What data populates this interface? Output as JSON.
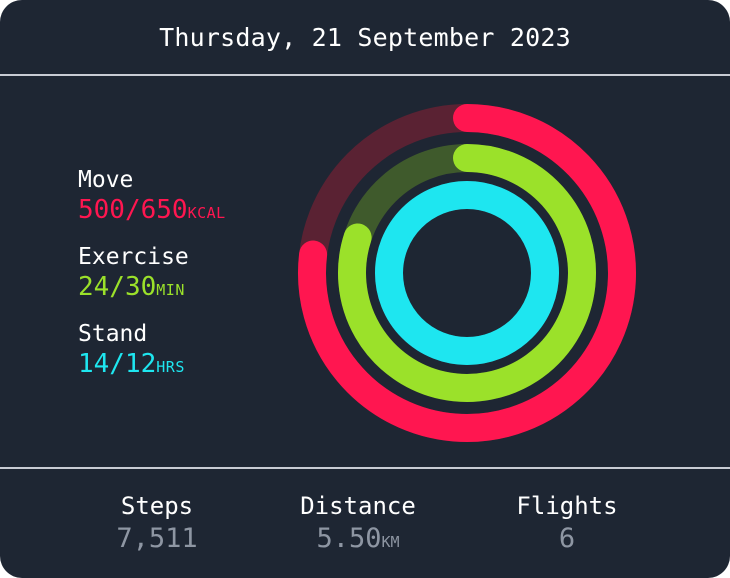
{
  "header": {
    "date": "Thursday, 21 September 2023"
  },
  "metrics": [
    {
      "name": "move",
      "label": "Move",
      "value": "500/650",
      "unit": "KCAL",
      "color": "#ff1650",
      "track_color": "#5a2233",
      "progress": 0.769
    },
    {
      "name": "exercise",
      "label": "Exercise",
      "value": "24/30",
      "unit": "MIN",
      "color": "#9be12a",
      "track_color": "#3f5a2c",
      "progress": 0.8
    },
    {
      "name": "stand",
      "label": "Stand",
      "value": "14/12",
      "unit": "HRS",
      "color": "#1ee6f0",
      "track_color": "#1f5a6a",
      "progress": 1.0
    }
  ],
  "stats": [
    {
      "name": "steps",
      "label": "Steps",
      "value": "7,511",
      "unit": ""
    },
    {
      "name": "distance",
      "label": "Distance",
      "value": "5.50",
      "unit": "KM"
    },
    {
      "name": "flights",
      "label": "Flights",
      "value": "6",
      "unit": ""
    }
  ],
  "colors": {
    "background": "#1e2633",
    "divider": "#c8ccd4",
    "secondary_text": "#8e96a3"
  }
}
